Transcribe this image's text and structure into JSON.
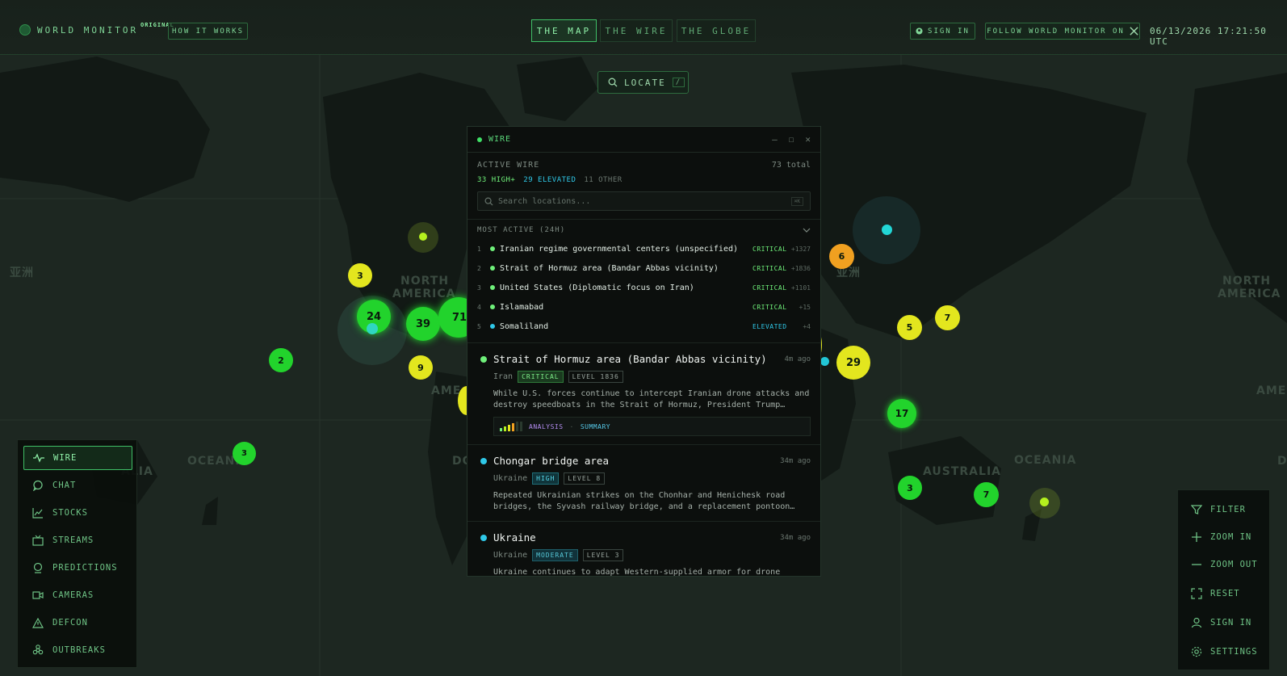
{
  "brand": {
    "name": "WORLD MONITOR",
    "badge": "ORIGINAL"
  },
  "header": {
    "how_it_works": "HOW IT WORKS",
    "tabs": [
      "THE MAP",
      "THE WIRE",
      "THE GLOBE"
    ],
    "active_tab": "THE MAP",
    "sign_in": "SIGN IN",
    "follow": "FOLLOW WORLD MONITOR ON",
    "clock": "06/13/2026 17:21:50 UTC"
  },
  "locate": {
    "label": "LOCATE",
    "shortcut": "/"
  },
  "map": {
    "labels": [
      "亚洲",
      "NORTH",
      "AMERICA",
      "亚洲",
      "NORTH",
      "AMERICA",
      "AUSTRALIA",
      "OCEANIA",
      "OCEANIA",
      "ALIA",
      "AME",
      "AME",
      "DO",
      "D"
    ],
    "markers": [
      "3",
      "24",
      "39",
      "71",
      "2",
      "9",
      "3",
      "6",
      "5",
      "7",
      "29",
      "17",
      "3",
      "7"
    ]
  },
  "wire": {
    "title": "WIRE",
    "active_label": "ACTIVE WIRE",
    "total": "73 total",
    "counts": {
      "high": "33 HIGH+",
      "elevated": "29 ELEVATED",
      "other": "11 OTHER"
    },
    "search_placeholder": "Search locations...",
    "search_shortcut": "⌘K",
    "most_active_label": "MOST ACTIVE (24H)",
    "most_active": [
      {
        "rank": "1",
        "name": "Iranian regime governmental centers (unspecified)",
        "severity": "CRITICAL",
        "count": "+1327"
      },
      {
        "rank": "2",
        "name": "Strait of Hormuz area (Bandar Abbas vicinity)",
        "severity": "CRITICAL",
        "count": "+1836"
      },
      {
        "rank": "3",
        "name": "United States (Diplomatic focus on Iran)",
        "severity": "CRITICAL",
        "count": "+1101"
      },
      {
        "rank": "4",
        "name": "Islamabad",
        "severity": "CRITICAL",
        "count": "+15"
      },
      {
        "rank": "5",
        "name": "Somaliland",
        "severity": "ELEVATED",
        "count": "+4"
      }
    ],
    "items": [
      {
        "title": "Strait of Hormuz area (Bandar Abbas vicinity)",
        "time": "4m ago",
        "country": "Iran",
        "severity": "CRITICAL",
        "level": "LEVEL 1836",
        "body": "While U.S. forces continue to intercept Iranian drone attacks and destroy speedboats in the Strait of Hormuz, President Trump…",
        "analysis": "ANALYSIS",
        "summary": "SUMMARY"
      },
      {
        "title": "Chongar bridge area",
        "time": "34m ago",
        "country": "Ukraine",
        "severity": "HIGH",
        "level": "LEVEL 8",
        "body": "Repeated Ukrainian strikes on the Chonhar and Henichesk road bridges, the Syvash railway bridge, and a replacement pontoon…"
      },
      {
        "title": "Ukraine",
        "time": "34m ago",
        "country": "Ukraine",
        "severity": "MODERATE",
        "level": "LEVEL 3",
        "body": "Ukraine continues to adapt Western-supplied armor for drone warfare while European funding and domestic production…"
      }
    ]
  },
  "nav": [
    "WIRE",
    "CHAT",
    "STOCKS",
    "STREAMS",
    "PREDICTIONS",
    "CAMERAS",
    "DEFCON",
    "OUTBREAKS"
  ],
  "controls": [
    "FILTER",
    "ZOOM IN",
    "ZOOM OUT",
    "RESET",
    "SIGN IN",
    "SETTINGS"
  ],
  "colors": {
    "critical": "#6ff07a",
    "elevated": "#2fc8e8",
    "accent": "#3fbf66",
    "marker_green": "#22d32c",
    "marker_yellow": "#e3e61e",
    "marker_orange": "#f0a020"
  }
}
